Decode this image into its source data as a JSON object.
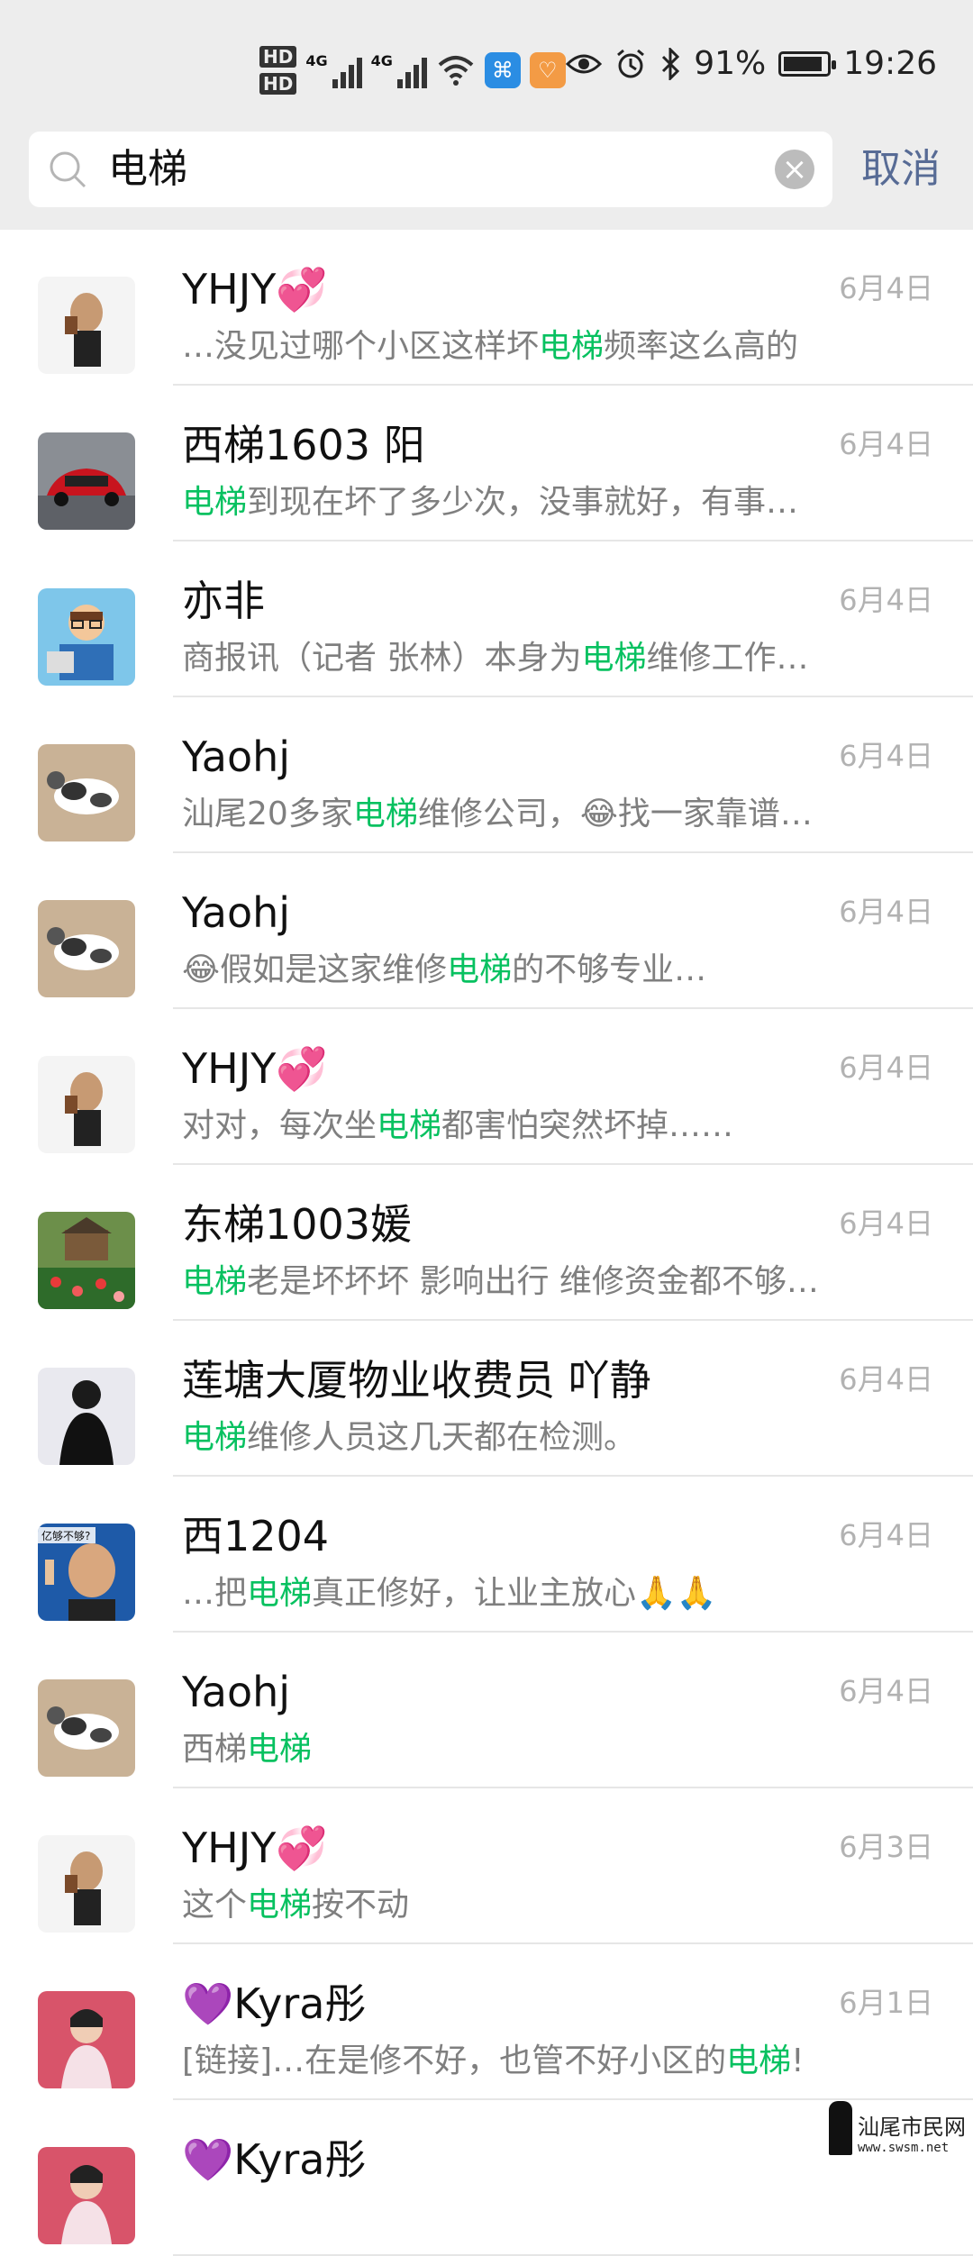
{
  "status_bar": {
    "hd1": "HD",
    "hd2": "HD",
    "net1": "4G",
    "net2": "4G",
    "battery": "91%",
    "battery_level": 0.91,
    "time": "19:26"
  },
  "search": {
    "query": "电梯",
    "cancel_label": "取消"
  },
  "results": [
    {
      "name": "YHJY",
      "name_emoji": "💞",
      "date": "6月4日",
      "snippet": [
        "…没见过哪个小区这样坏",
        "电梯",
        "频率这么高的"
      ]
    },
    {
      "name": "西梯1603 阳",
      "name_emoji": "",
      "date": "6月4日",
      "snippet": [
        "",
        "电梯",
        "到现在坏了多少次，没事就好，有事…"
      ]
    },
    {
      "name": "亦非",
      "name_emoji": "",
      "date": "6月4日",
      "snippet": [
        "商报讯（记者 张林）本身为",
        "电梯",
        "维修工作…"
      ]
    },
    {
      "name": "Yaohj",
      "name_emoji": "",
      "date": "6月4日",
      "snippet": [
        "汕尾20多家",
        "电梯",
        "维修公司，😂找一家靠谱…"
      ]
    },
    {
      "name": "Yaohj",
      "name_emoji": "",
      "date": "6月4日",
      "snippet": [
        "😂假如是这家维修",
        "电梯",
        "的不够专业…"
      ]
    },
    {
      "name": "YHJY",
      "name_emoji": "💞",
      "date": "6月4日",
      "snippet": [
        "对对，每次坐",
        "电梯",
        "都害怕突然坏掉……"
      ]
    },
    {
      "name": "东梯1003媛",
      "name_emoji": "",
      "date": "6月4日",
      "snippet": [
        "",
        "电梯",
        "老是坏坏坏 影响出行 维修资金都不够…"
      ]
    },
    {
      "name": "莲塘大厦物业收费员  吖静",
      "name_emoji": "",
      "date": "6月4日",
      "snippet": [
        "",
        "电梯",
        "维修人员这几天都在检测。"
      ]
    },
    {
      "name": "西1204",
      "name_emoji": "",
      "date": "6月4日",
      "snippet": [
        "…把",
        "电梯",
        "真正修好，让业主放心🙏🙏"
      ]
    },
    {
      "name": "Yaohj",
      "name_emoji": "",
      "date": "6月4日",
      "snippet": [
        "西梯",
        "电梯",
        ""
      ]
    },
    {
      "name": "YHJY",
      "name_emoji": "💞",
      "date": "6月3日",
      "snippet": [
        "这个",
        "电梯",
        "按不动"
      ]
    },
    {
      "name": "Kyra彤",
      "name_emoji": "💜",
      "date": "6月1日",
      "snippet": [
        "[链接]…在是修不好，也管不好小区的",
        "电梯",
        "!"
      ]
    },
    {
      "name": "Kyra彤",
      "name_emoji": "💜",
      "date": "",
      "snippet": [
        "",
        "",
        ""
      ]
    }
  ],
  "avatar_text": {
    "xi1204": "亿够不够?"
  },
  "watermark": {
    "title": "汕尾市民网",
    "url": "www.swsm.net"
  },
  "colors": {
    "highlight": "#07c160",
    "cancel": "#576b95",
    "background": "#ededed"
  }
}
